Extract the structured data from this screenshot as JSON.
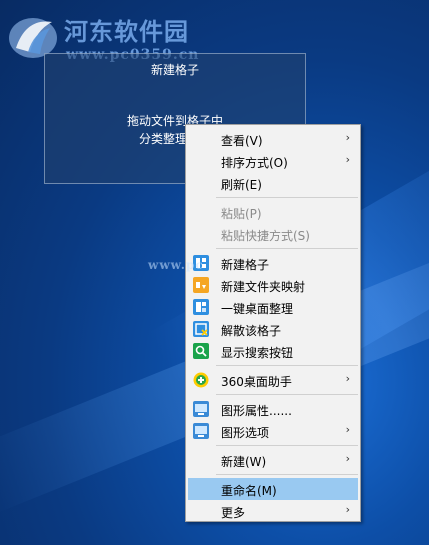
{
  "watermark": {
    "title": "河东软件园",
    "url": "www.pc0359.cn",
    "url_overlay": "www.pc"
  },
  "fence": {
    "title": "新建格子",
    "message_line1": "拖动文件到格子中",
    "message_line2": "分类整理你的"
  },
  "menu": {
    "items": [
      {
        "label": "查看(V)",
        "submenu": true
      },
      {
        "label": "排序方式(O)",
        "submenu": true
      },
      {
        "label": "刷新(E)"
      },
      {
        "label": "粘贴(P)",
        "disabled": true
      },
      {
        "label": "粘贴快捷方式(S)",
        "disabled": true
      },
      {
        "label": "新建格子",
        "icon": "fence-grid-icon"
      },
      {
        "label": "新建文件夹映射",
        "icon": "folder-map-icon"
      },
      {
        "label": "一键桌面整理",
        "icon": "desktop-organize-icon"
      },
      {
        "label": "解散该格子",
        "icon": "dissolve-fence-icon"
      },
      {
        "label": "显示搜索按钮",
        "icon": "search-icon"
      },
      {
        "label": "360桌面助手",
        "icon": "360-assistant-icon",
        "submenu": true
      },
      {
        "label": "图形属性......",
        "icon": "graphics-props-icon"
      },
      {
        "label": "图形选项",
        "icon": "graphics-options-icon",
        "submenu": true
      },
      {
        "label": "新建(W)",
        "submenu": true
      },
      {
        "label": "重命名(M)",
        "highlighted": true
      },
      {
        "label": "更多",
        "submenu": true
      }
    ],
    "submenu_arrow": "›"
  },
  "colors": {
    "menu_bg": "#f2f2f2",
    "highlight": "#99c9f1",
    "disabled_text": "#8a8a8a"
  }
}
